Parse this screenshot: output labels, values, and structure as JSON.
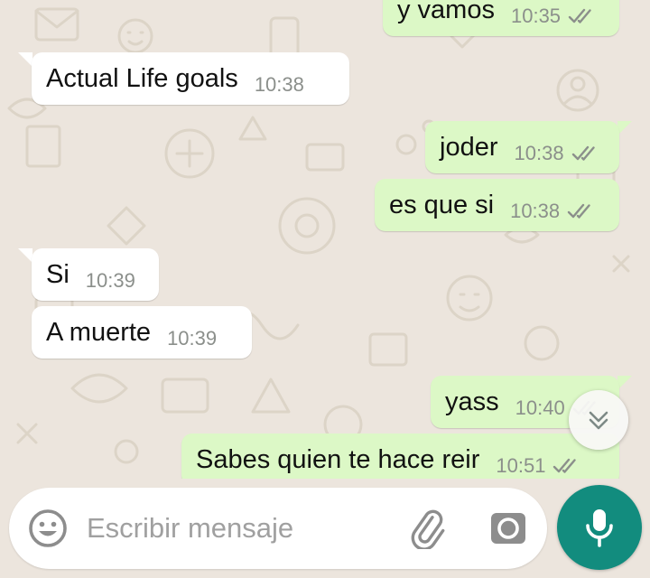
{
  "messages": [
    {
      "text": "y vamos",
      "time": "10:35",
      "direction": "out",
      "status": "read"
    },
    {
      "text": "Actual Life goals",
      "time": "10:38",
      "direction": "in"
    },
    {
      "text": "joder",
      "time": "10:38",
      "direction": "out",
      "status": "read"
    },
    {
      "text": "es que si",
      "time": "10:38",
      "direction": "out",
      "status": "read"
    },
    {
      "text": "Si",
      "time": "10:39",
      "direction": "in"
    },
    {
      "text": "A muerte",
      "time": "10:39",
      "direction": "in"
    },
    {
      "text": "yass",
      "time": "10:40",
      "direction": "out",
      "status": "read"
    },
    {
      "text": "Sabes quien te hace reir",
      "time": "10:51",
      "direction": "out",
      "status": "read"
    }
  ],
  "composer": {
    "placeholder": "Escribir mensaje",
    "value": ""
  },
  "icons": {
    "emoji": "emoji-icon",
    "attach": "paperclip-icon",
    "camera": "camera-icon",
    "mic": "microphone-icon",
    "scroll": "double-chevron-down-icon"
  },
  "colors": {
    "background": "#ece5dd",
    "incoming_bubble": "#ffffff",
    "outgoing_bubble": "#dcf8c6",
    "accent": "#128c7e",
    "read_ticks": "#8b8f8b"
  }
}
